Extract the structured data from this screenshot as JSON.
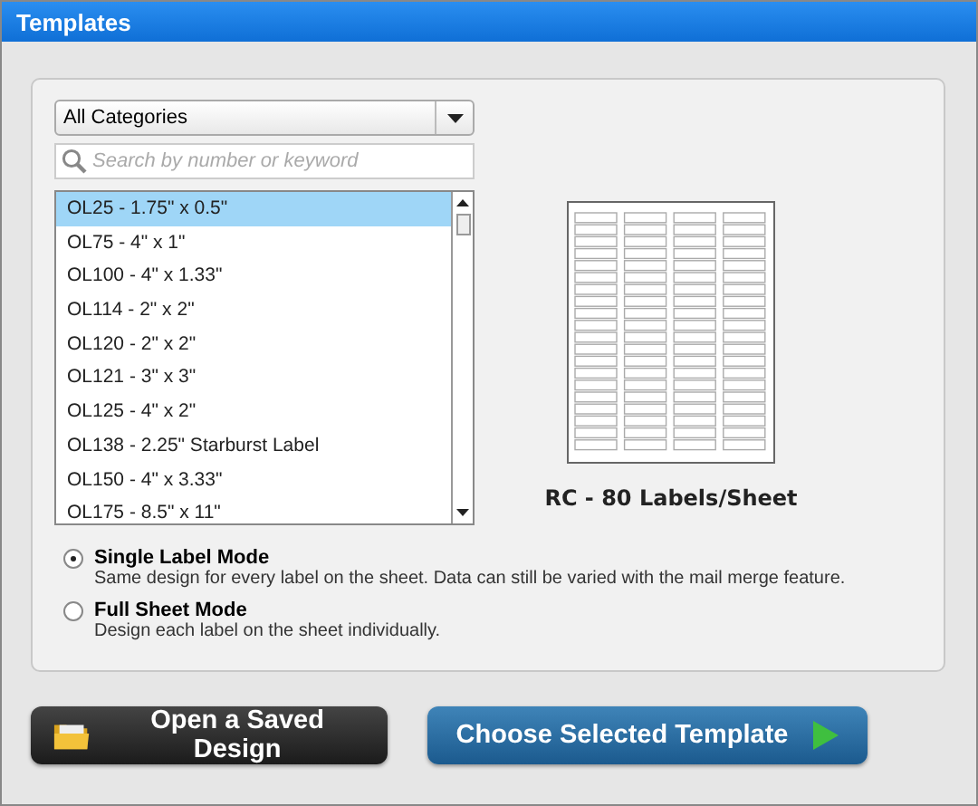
{
  "window": {
    "title": "Templates"
  },
  "category_dropdown": {
    "value": "All Categories"
  },
  "search": {
    "placeholder": "Search by number or keyword"
  },
  "templates": [
    {
      "label": "OL25 - 1.75\" x 0.5\"",
      "selected": true
    },
    {
      "label": "OL75 - 4\" x 1\"",
      "selected": false
    },
    {
      "label": "OL100 - 4\" x 1.33\"",
      "selected": false
    },
    {
      "label": "OL114 - 2\" x 2\"",
      "selected": false
    },
    {
      "label": "OL120 - 2\" x 2\"",
      "selected": false
    },
    {
      "label": "OL121 - 3\" x 3\"",
      "selected": false
    },
    {
      "label": "OL125 - 4\" x 2\"",
      "selected": false
    },
    {
      "label": "OL138 - 2.25\" Starburst Label",
      "selected": false
    },
    {
      "label": "OL150 - 4\" x 3.33\"",
      "selected": false
    },
    {
      "label": "OL175 - 8.5\" x 11\"",
      "selected": false
    }
  ],
  "preview": {
    "caption": "RC - 80 Labels/Sheet"
  },
  "modes": [
    {
      "label": "Single Label Mode",
      "description": "Same design for every label on the sheet.  Data can still be varied with the mail merge feature.",
      "selected": true
    },
    {
      "label": "Full Sheet Mode",
      "description": "Design each label on the sheet individually.",
      "selected": false
    }
  ],
  "buttons": [
    {
      "label": "Open a Saved Design",
      "kind": "open"
    },
    {
      "label": "Choose Selected Template",
      "kind": "choose"
    }
  ]
}
